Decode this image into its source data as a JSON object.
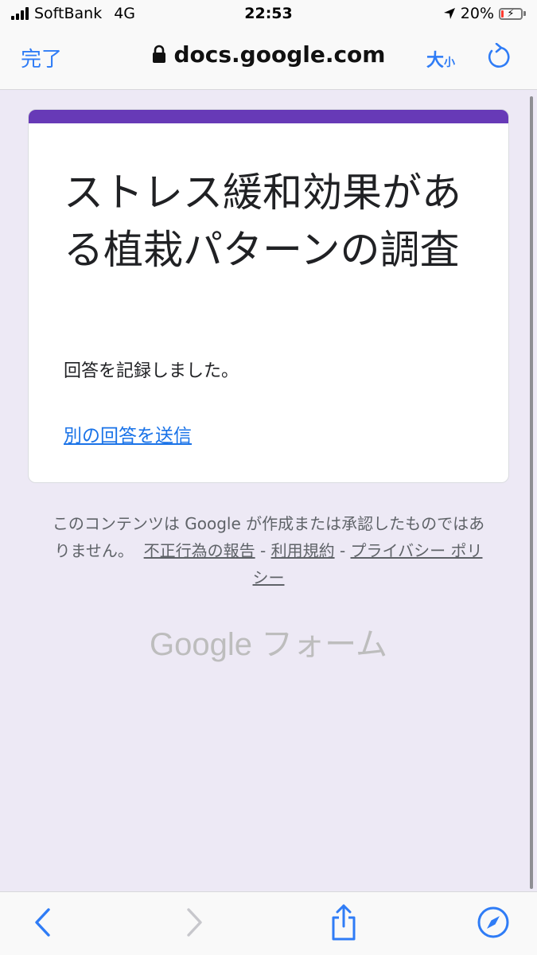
{
  "status_bar": {
    "carrier": "SoftBank",
    "network": "4G",
    "time": "22:53",
    "battery": "20%",
    "battery_level": 0.2
  },
  "browser": {
    "done_label": "完了",
    "url": "docs.google.com",
    "text_size_big": "大",
    "text_size_small": "小"
  },
  "form": {
    "title": "ストレス緩和効果がある植栽パターンの調査",
    "confirmation": "回答を記録しました。",
    "another_response": "別の回答を送信"
  },
  "footer": {
    "disclaimer_text": "このコンテンツは Google が作成または承認したものではありません。",
    "report_abuse": "不正行為の報告",
    "separator": "-",
    "terms": "利用規約",
    "privacy": "プライバシー ポリシー",
    "logo_google": "Google",
    "logo_forms": "フォーム"
  },
  "colors": {
    "accent": "#2f7cf6",
    "form_theme": "#673ab7",
    "link": "#1a73e8",
    "page_background": "#ede9f5"
  },
  "icons": {
    "lock": "lock-icon",
    "reload": "reload-icon",
    "back": "chevron-left-icon",
    "forward": "chevron-right-icon",
    "share": "share-icon",
    "safari": "compass-icon"
  }
}
